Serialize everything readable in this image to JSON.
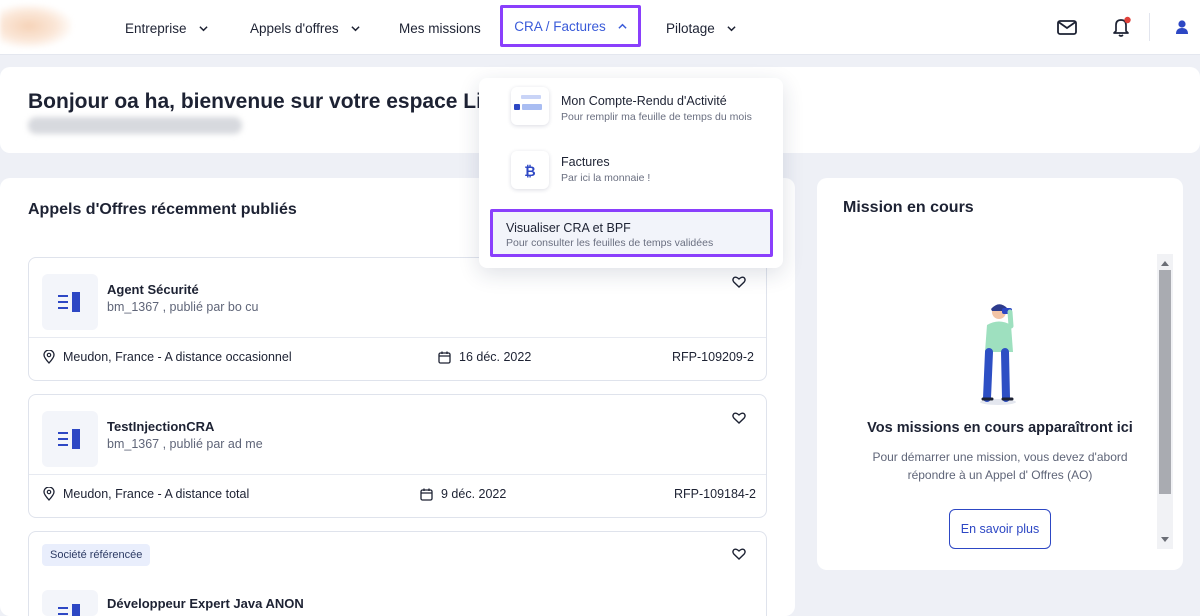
{
  "nav": {
    "items": [
      {
        "label": "Entreprise"
      },
      {
        "label": "Appels d'offres"
      },
      {
        "label": "Mes missions"
      },
      {
        "label": "CRA / Factures"
      },
      {
        "label": "Pilotage"
      }
    ]
  },
  "welcome": {
    "title": "Bonjour oa ha, bienvenue sur votre espace Littl"
  },
  "dropdown": {
    "items": [
      {
        "title": "Mon Compte-Rendu d'Activité",
        "subtitle": "Pour remplir ma feuille de temps du mois"
      },
      {
        "title": "Factures",
        "subtitle": "Par ici la monnaie !"
      },
      {
        "title": "Visualiser CRA et BPF",
        "subtitle": "Pour consulter les feuilles de temps validées"
      }
    ]
  },
  "offers": {
    "title": "Appels d'Offres récemment publiés",
    "cards": [
      {
        "title": "Agent Sécurité",
        "subtitle": "bm_1367 , publié par bo cu",
        "location": "Meudon, France - A distance occasionnel",
        "date": "16 déc. 2022",
        "ref": "RFP-109209-2"
      },
      {
        "title": "TestInjectionCRA",
        "subtitle": "bm_1367 , publié par ad me",
        "location": "Meudon, France - A distance total",
        "date": "9 déc. 2022",
        "ref": "RFP-109184-2"
      },
      {
        "badge": "Société référencée",
        "title": "Développeur Expert Java ANON"
      }
    ]
  },
  "mission": {
    "title": "Mission en cours",
    "empty_title": "Vos missions en cours apparaîtront ici",
    "empty_text": "Pour démarrer une mission, vous devez d'abord répondre à un Appel d' Offres (AO)",
    "button": "En savoir plus"
  },
  "colors": {
    "accent": "#2d47c4",
    "highlight": "#8a3ffc",
    "notification": "#e0413a"
  },
  "icons": [
    "mail-icon",
    "bell-icon",
    "user-icon",
    "heart-icon",
    "location-pin-icon",
    "calendar-icon",
    "document-icon",
    "bitcoin-icon",
    "chevron-down-icon",
    "chevron-up-icon"
  ]
}
